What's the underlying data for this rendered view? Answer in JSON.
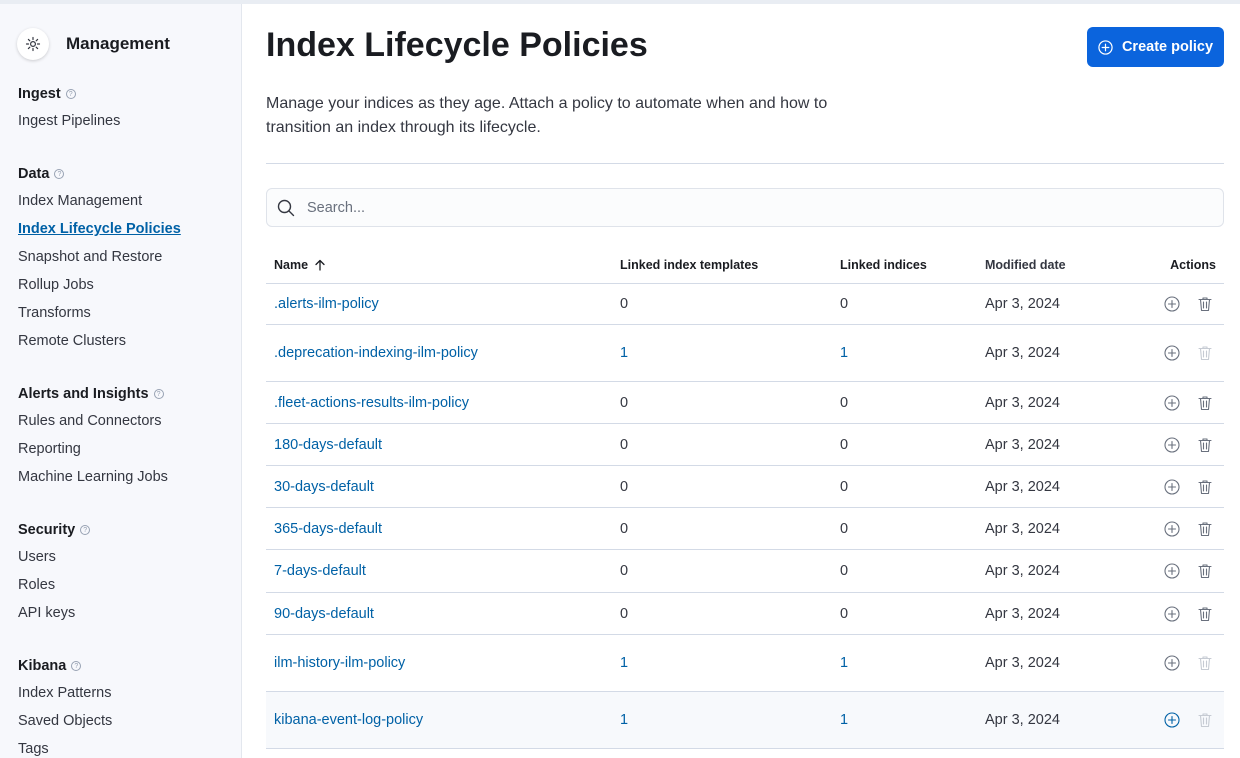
{
  "sidebar": {
    "title": "Management",
    "groups": [
      {
        "title": "Ingest",
        "items": [
          "Ingest Pipelines"
        ]
      },
      {
        "title": "Data",
        "items": [
          "Index Management",
          "Index Lifecycle Policies",
          "Snapshot and Restore",
          "Rollup Jobs",
          "Transforms",
          "Remote Clusters"
        ]
      },
      {
        "title": "Alerts and Insights",
        "items": [
          "Rules and Connectors",
          "Reporting",
          "Machine Learning Jobs"
        ]
      },
      {
        "title": "Security",
        "items": [
          "Users",
          "Roles",
          "API keys"
        ]
      },
      {
        "title": "Kibana",
        "items": [
          "Index Patterns",
          "Saved Objects",
          "Tags"
        ]
      }
    ],
    "active_item": "Index Lifecycle Policies"
  },
  "page": {
    "title": "Index Lifecycle Policies",
    "description": "Manage your indices as they age. Attach a policy to automate when and how to transition an index through its lifecycle.",
    "create_button": "Create policy"
  },
  "search": {
    "placeholder": "Search...",
    "value": ""
  },
  "table": {
    "headers": {
      "name": "Name",
      "templates": "Linked index templates",
      "indices": "Linked indices",
      "date": "Modified date",
      "actions": "Actions"
    },
    "sort": {
      "column": "Name",
      "direction": "ascending"
    },
    "rows": [
      {
        "name": ".alerts-ilm-policy",
        "templates": "0",
        "indices": "0",
        "date": "Apr 3, 2024",
        "delete_enabled": true
      },
      {
        "name": ".deprecation-indexing-ilm-policy",
        "templates": "1",
        "indices": "1",
        "date": "Apr 3, 2024",
        "delete_enabled": false
      },
      {
        "name": ".fleet-actions-results-ilm-policy",
        "templates": "0",
        "indices": "0",
        "date": "Apr 3, 2024",
        "delete_enabled": true
      },
      {
        "name": "180-days-default",
        "templates": "0",
        "indices": "0",
        "date": "Apr 3, 2024",
        "delete_enabled": true
      },
      {
        "name": "30-days-default",
        "templates": "0",
        "indices": "0",
        "date": "Apr 3, 2024",
        "delete_enabled": true
      },
      {
        "name": "365-days-default",
        "templates": "0",
        "indices": "0",
        "date": "Apr 3, 2024",
        "delete_enabled": true
      },
      {
        "name": "7-days-default",
        "templates": "0",
        "indices": "0",
        "date": "Apr 3, 2024",
        "delete_enabled": true
      },
      {
        "name": "90-days-default",
        "templates": "0",
        "indices": "0",
        "date": "Apr 3, 2024",
        "delete_enabled": true
      },
      {
        "name": "ilm-history-ilm-policy",
        "templates": "1",
        "indices": "1",
        "date": "Apr 3, 2024",
        "delete_enabled": false
      },
      {
        "name": "kibana-event-log-policy",
        "templates": "1",
        "indices": "1",
        "date": "Apr 3, 2024",
        "delete_enabled": false
      }
    ]
  },
  "colors": {
    "accent": "#0b64dd",
    "link": "#0061a6",
    "text": "#343741"
  }
}
